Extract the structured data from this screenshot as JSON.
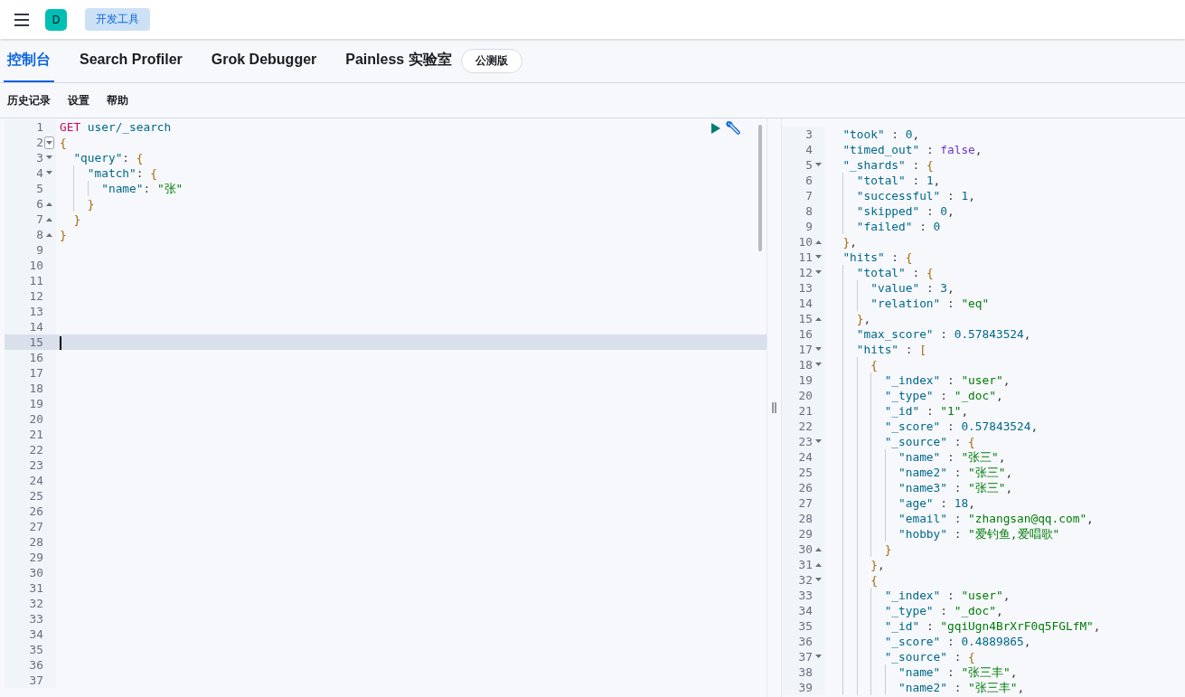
{
  "header": {
    "avatar": "D",
    "breadcrumb": "开发工具"
  },
  "tabs": [
    {
      "label": "控制台",
      "selected": true
    },
    {
      "label": "Search Profiler",
      "selected": false
    },
    {
      "label": "Grok Debugger",
      "selected": false
    },
    {
      "label": "Painless 实验室",
      "selected": false
    }
  ],
  "beta_badge": "公测版",
  "toolbar": [
    "历史记录",
    "设置",
    "帮助"
  ],
  "request_editor": {
    "lines": [
      {
        "n": "1",
        "active": false,
        "tokens": [
          {
            "kind": "method",
            "text": "GET"
          },
          {
            "kind": "url",
            "text": " user/_search"
          }
        ]
      },
      {
        "n": "2",
        "active": false,
        "fold_start": true,
        "hovered": true,
        "tokens": [
          {
            "kind": "brace",
            "text": "{"
          }
        ]
      },
      {
        "n": "3",
        "active": false,
        "fold_start": true,
        "tokens": [
          {
            "kind": "key",
            "text": "  \"query\""
          },
          {
            "kind": "punct",
            "text": ": "
          },
          {
            "kind": "brace",
            "text": "{"
          }
        ]
      },
      {
        "n": "4",
        "active": false,
        "fold_start": true,
        "tokens": [
          {
            "kind": "key",
            "text": "    \"match\""
          },
          {
            "kind": "punct",
            "text": ": "
          },
          {
            "kind": "brace",
            "text": "{"
          }
        ]
      },
      {
        "n": "5",
        "active": false,
        "tokens": [
          {
            "kind": "key",
            "text": "      \"name\""
          },
          {
            "kind": "punct",
            "text": ": "
          },
          {
            "kind": "string",
            "text": "\"张\""
          }
        ]
      },
      {
        "n": "6",
        "active": false,
        "fold_end": true,
        "tokens": [
          {
            "kind": "brace",
            "text": "    }"
          }
        ]
      },
      {
        "n": "7",
        "active": false,
        "fold_end": true,
        "tokens": [
          {
            "kind": "brace",
            "text": "  }"
          }
        ]
      },
      {
        "n": "8",
        "active": false,
        "fold_end": true,
        "tokens": [
          {
            "kind": "brace",
            "text": "}"
          }
        ]
      },
      {
        "n": "9",
        "active": false
      },
      {
        "n": "10",
        "active": false
      },
      {
        "n": "11",
        "active": false
      },
      {
        "n": "12",
        "active": false
      },
      {
        "n": "13",
        "active": false
      },
      {
        "n": "14",
        "active": false
      },
      {
        "n": "15",
        "active": true
      },
      {
        "n": "16",
        "active": false
      },
      {
        "n": "17",
        "active": false
      },
      {
        "n": "18",
        "active": false
      },
      {
        "n": "19",
        "active": false
      },
      {
        "n": "20",
        "active": false
      },
      {
        "n": "21",
        "active": false
      },
      {
        "n": "22",
        "active": false
      },
      {
        "n": "23",
        "active": false
      },
      {
        "n": "24",
        "active": false
      },
      {
        "n": "25",
        "active": false
      },
      {
        "n": "26",
        "active": false
      },
      {
        "n": "27",
        "active": false
      },
      {
        "n": "28",
        "active": false
      },
      {
        "n": "29",
        "active": false
      },
      {
        "n": "30",
        "active": false
      },
      {
        "n": "31",
        "active": false
      },
      {
        "n": "32",
        "active": false
      },
      {
        "n": "33",
        "active": false
      },
      {
        "n": "34",
        "active": false
      },
      {
        "n": "35",
        "active": false
      },
      {
        "n": "36",
        "active": false
      },
      {
        "n": "37",
        "active": false
      }
    ]
  },
  "response_editor": {
    "lines": [
      {
        "n": "3",
        "tokens": [
          {
            "kind": "key",
            "text": "  \"took\""
          },
          {
            "kind": "punct",
            "text": " : "
          },
          {
            "kind": "number",
            "text": "0"
          },
          {
            "kind": "punct",
            "text": ","
          }
        ]
      },
      {
        "n": "4",
        "tokens": [
          {
            "kind": "key",
            "text": "  \"timed_out\""
          },
          {
            "kind": "punct",
            "text": " : "
          },
          {
            "kind": "bool",
            "text": "false"
          },
          {
            "kind": "punct",
            "text": ","
          }
        ]
      },
      {
        "n": "5",
        "fold_start": true,
        "tokens": [
          {
            "kind": "key",
            "text": "  \"_shards\""
          },
          {
            "kind": "punct",
            "text": " : "
          },
          {
            "kind": "brace",
            "text": "{"
          }
        ]
      },
      {
        "n": "6",
        "tokens": [
          {
            "kind": "key",
            "text": "    \"total\""
          },
          {
            "kind": "punct",
            "text": " : "
          },
          {
            "kind": "number",
            "text": "1"
          },
          {
            "kind": "punct",
            "text": ","
          }
        ]
      },
      {
        "n": "7",
        "tokens": [
          {
            "kind": "key",
            "text": "    \"successful\""
          },
          {
            "kind": "punct",
            "text": " : "
          },
          {
            "kind": "number",
            "text": "1"
          },
          {
            "kind": "punct",
            "text": ","
          }
        ]
      },
      {
        "n": "8",
        "tokens": [
          {
            "kind": "key",
            "text": "    \"skipped\""
          },
          {
            "kind": "punct",
            "text": " : "
          },
          {
            "kind": "number",
            "text": "0"
          },
          {
            "kind": "punct",
            "text": ","
          }
        ]
      },
      {
        "n": "9",
        "tokens": [
          {
            "kind": "key",
            "text": "    \"failed\""
          },
          {
            "kind": "punct",
            "text": " : "
          },
          {
            "kind": "number",
            "text": "0"
          }
        ]
      },
      {
        "n": "10",
        "fold_end": true,
        "tokens": [
          {
            "kind": "brace",
            "text": "  }"
          },
          {
            "kind": "punct",
            "text": ","
          }
        ]
      },
      {
        "n": "11",
        "fold_start": true,
        "tokens": [
          {
            "kind": "key",
            "text": "  \"hits\""
          },
          {
            "kind": "punct",
            "text": " : "
          },
          {
            "kind": "brace",
            "text": "{"
          }
        ]
      },
      {
        "n": "12",
        "fold_start": true,
        "tokens": [
          {
            "kind": "key",
            "text": "    \"total\""
          },
          {
            "kind": "punct",
            "text": " : "
          },
          {
            "kind": "brace",
            "text": "{"
          }
        ]
      },
      {
        "n": "13",
        "tokens": [
          {
            "kind": "key",
            "text": "      \"value\""
          },
          {
            "kind": "punct",
            "text": " : "
          },
          {
            "kind": "number",
            "text": "3"
          },
          {
            "kind": "punct",
            "text": ","
          }
        ]
      },
      {
        "n": "14",
        "tokens": [
          {
            "kind": "key",
            "text": "      \"relation\""
          },
          {
            "kind": "punct",
            "text": " : "
          },
          {
            "kind": "string",
            "text": "\"eq\""
          }
        ]
      },
      {
        "n": "15",
        "fold_end": true,
        "tokens": [
          {
            "kind": "brace",
            "text": "    }"
          },
          {
            "kind": "punct",
            "text": ","
          }
        ]
      },
      {
        "n": "16",
        "tokens": [
          {
            "kind": "key",
            "text": "    \"max_score\""
          },
          {
            "kind": "punct",
            "text": " : "
          },
          {
            "kind": "number",
            "text": "0.57843524"
          },
          {
            "kind": "punct",
            "text": ","
          }
        ]
      },
      {
        "n": "17",
        "fold_start": true,
        "tokens": [
          {
            "kind": "key",
            "text": "    \"hits\""
          },
          {
            "kind": "punct",
            "text": " : "
          },
          {
            "kind": "brace",
            "text": "["
          }
        ]
      },
      {
        "n": "18",
        "fold_start": true,
        "tokens": [
          {
            "kind": "brace",
            "text": "      {"
          }
        ]
      },
      {
        "n": "19",
        "tokens": [
          {
            "kind": "key",
            "text": "        \"_index\""
          },
          {
            "kind": "punct",
            "text": " : "
          },
          {
            "kind": "string",
            "text": "\"user\""
          },
          {
            "kind": "punct",
            "text": ","
          }
        ]
      },
      {
        "n": "20",
        "tokens": [
          {
            "kind": "key",
            "text": "        \"_type\""
          },
          {
            "kind": "punct",
            "text": " : "
          },
          {
            "kind": "string",
            "text": "\"_doc\""
          },
          {
            "kind": "punct",
            "text": ","
          }
        ]
      },
      {
        "n": "21",
        "tokens": [
          {
            "kind": "key",
            "text": "        \"_id\""
          },
          {
            "kind": "punct",
            "text": " : "
          },
          {
            "kind": "string",
            "text": "\"1\""
          },
          {
            "kind": "punct",
            "text": ","
          }
        ]
      },
      {
        "n": "22",
        "tokens": [
          {
            "kind": "key",
            "text": "        \"_score\""
          },
          {
            "kind": "punct",
            "text": " : "
          },
          {
            "kind": "number",
            "text": "0.57843524"
          },
          {
            "kind": "punct",
            "text": ","
          }
        ]
      },
      {
        "n": "23",
        "fold_start": true,
        "tokens": [
          {
            "kind": "key",
            "text": "        \"_source\""
          },
          {
            "kind": "punct",
            "text": " : "
          },
          {
            "kind": "brace",
            "text": "{"
          }
        ]
      },
      {
        "n": "24",
        "tokens": [
          {
            "kind": "key",
            "text": "          \"name\""
          },
          {
            "kind": "punct",
            "text": " : "
          },
          {
            "kind": "string",
            "text": "\"张三\""
          },
          {
            "kind": "punct",
            "text": ","
          }
        ]
      },
      {
        "n": "25",
        "tokens": [
          {
            "kind": "key",
            "text": "          \"name2\""
          },
          {
            "kind": "punct",
            "text": " : "
          },
          {
            "kind": "string",
            "text": "\"张三\""
          },
          {
            "kind": "punct",
            "text": ","
          }
        ]
      },
      {
        "n": "26",
        "tokens": [
          {
            "kind": "key",
            "text": "          \"name3\""
          },
          {
            "kind": "punct",
            "text": " : "
          },
          {
            "kind": "string",
            "text": "\"张三\""
          },
          {
            "kind": "punct",
            "text": ","
          }
        ]
      },
      {
        "n": "27",
        "tokens": [
          {
            "kind": "key",
            "text": "          \"age\""
          },
          {
            "kind": "punct",
            "text": " : "
          },
          {
            "kind": "number",
            "text": "18"
          },
          {
            "kind": "punct",
            "text": ","
          }
        ]
      },
      {
        "n": "28",
        "tokens": [
          {
            "kind": "key",
            "text": "          \"email\""
          },
          {
            "kind": "punct",
            "text": " : "
          },
          {
            "kind": "string",
            "text": "\"zhangsan@qq.com\""
          },
          {
            "kind": "punct",
            "text": ","
          }
        ]
      },
      {
        "n": "29",
        "tokens": [
          {
            "kind": "key",
            "text": "          \"hobby\""
          },
          {
            "kind": "punct",
            "text": " : "
          },
          {
            "kind": "string",
            "text": "\"爱钓鱼,爱唱歌\""
          }
        ]
      },
      {
        "n": "30",
        "fold_end": true,
        "tokens": [
          {
            "kind": "brace",
            "text": "        }"
          }
        ]
      },
      {
        "n": "31",
        "fold_end": true,
        "tokens": [
          {
            "kind": "brace",
            "text": "      }"
          },
          {
            "kind": "punct",
            "text": ","
          }
        ]
      },
      {
        "n": "32",
        "fold_start": true,
        "tokens": [
          {
            "kind": "brace",
            "text": "      {"
          }
        ]
      },
      {
        "n": "33",
        "tokens": [
          {
            "kind": "key",
            "text": "        \"_index\""
          },
          {
            "kind": "punct",
            "text": " : "
          },
          {
            "kind": "string",
            "text": "\"user\""
          },
          {
            "kind": "punct",
            "text": ","
          }
        ]
      },
      {
        "n": "34",
        "tokens": [
          {
            "kind": "key",
            "text": "        \"_type\""
          },
          {
            "kind": "punct",
            "text": " : "
          },
          {
            "kind": "string",
            "text": "\"_doc\""
          },
          {
            "kind": "punct",
            "text": ","
          }
        ]
      },
      {
        "n": "35",
        "tokens": [
          {
            "kind": "key",
            "text": "        \"_id\""
          },
          {
            "kind": "punct",
            "text": " : "
          },
          {
            "kind": "string",
            "text": "\"gqiUgn4BrXrF0q5FGLfM\""
          },
          {
            "kind": "punct",
            "text": ","
          }
        ]
      },
      {
        "n": "36",
        "tokens": [
          {
            "kind": "key",
            "text": "        \"_score\""
          },
          {
            "kind": "punct",
            "text": " : "
          },
          {
            "kind": "number",
            "text": "0.4889865"
          },
          {
            "kind": "punct",
            "text": ","
          }
        ]
      },
      {
        "n": "37",
        "fold_start": true,
        "tokens": [
          {
            "kind": "key",
            "text": "        \"_source\""
          },
          {
            "kind": "punct",
            "text": " : "
          },
          {
            "kind": "brace",
            "text": "{"
          }
        ]
      },
      {
        "n": "38",
        "tokens": [
          {
            "kind": "key",
            "text": "          \"name\""
          },
          {
            "kind": "punct",
            "text": " : "
          },
          {
            "kind": "string",
            "text": "\"张三丰\""
          },
          {
            "kind": "punct",
            "text": ","
          }
        ]
      },
      {
        "n": "39",
        "tokens": [
          {
            "kind": "key",
            "text": "          \"name2\""
          },
          {
            "kind": "punct",
            "text": " : "
          },
          {
            "kind": "string",
            "text": "\"张三丰\""
          },
          {
            "kind": "punct",
            "text": ","
          }
        ]
      }
    ]
  }
}
